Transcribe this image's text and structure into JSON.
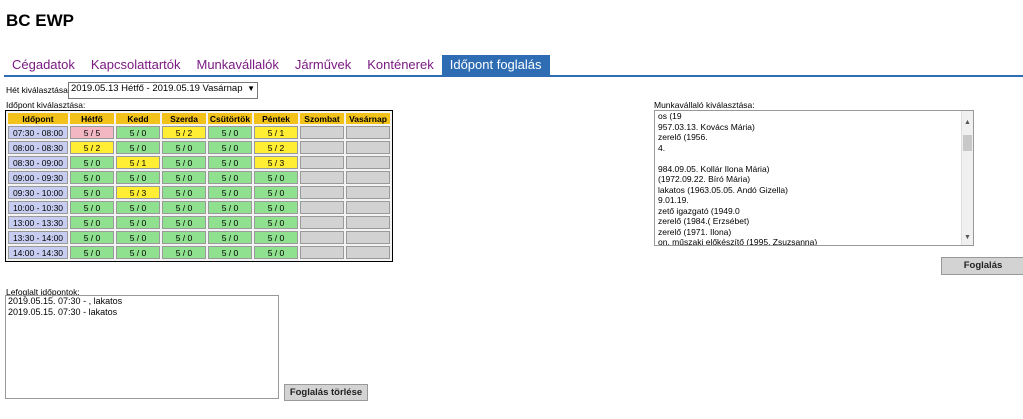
{
  "title": "BC EWP",
  "tabs": [
    {
      "label": "Cégadatok",
      "active": false
    },
    {
      "label": "Kapcsolattartók",
      "active": false
    },
    {
      "label": "Munkavállalók",
      "active": false
    },
    {
      "label": "Járművek",
      "active": false
    },
    {
      "label": "Konténerek",
      "active": false
    },
    {
      "label": "Időpont foglalás",
      "active": true
    }
  ],
  "week": {
    "label": "Hét kiválasztása:",
    "selected": "2019.05.13 Hétfő - 2019.05.19 Vasárnap"
  },
  "time_selection": {
    "label": "Időpont kiválasztása:",
    "header": [
      "Időpont",
      "Hétfő",
      "Kedd",
      "Szerda",
      "Csütörtök",
      "Péntek",
      "Szombat",
      "Vasárnap"
    ],
    "rows": [
      {
        "time": "07:30 - 08:00",
        "cells": [
          {
            "t": "5 / 5",
            "s": "red"
          },
          {
            "t": "5 / 0",
            "s": "grn"
          },
          {
            "t": "5 / 2",
            "s": "yel"
          },
          {
            "t": "5 / 0",
            "s": "grn"
          },
          {
            "t": "5 / 1",
            "s": "yel"
          },
          {
            "t": "",
            "s": "gry"
          },
          {
            "t": "",
            "s": "gry"
          }
        ]
      },
      {
        "time": "08:00 - 08:30",
        "cells": [
          {
            "t": "5 / 2",
            "s": "yel"
          },
          {
            "t": "5 / 0",
            "s": "grn"
          },
          {
            "t": "5 / 0",
            "s": "grn"
          },
          {
            "t": "5 / 0",
            "s": "grn"
          },
          {
            "t": "5 / 2",
            "s": "yel"
          },
          {
            "t": "",
            "s": "gry"
          },
          {
            "t": "",
            "s": "gry"
          }
        ]
      },
      {
        "time": "08:30 - 09:00",
        "cells": [
          {
            "t": "5 / 0",
            "s": "grn"
          },
          {
            "t": "5 / 1",
            "s": "yel"
          },
          {
            "t": "5 / 0",
            "s": "grn"
          },
          {
            "t": "5 / 0",
            "s": "grn"
          },
          {
            "t": "5 / 3",
            "s": "yel"
          },
          {
            "t": "",
            "s": "gry"
          },
          {
            "t": "",
            "s": "gry"
          }
        ]
      },
      {
        "time": "09:00 - 09:30",
        "cells": [
          {
            "t": "5 / 0",
            "s": "grn"
          },
          {
            "t": "5 / 0",
            "s": "grn"
          },
          {
            "t": "5 / 0",
            "s": "grn"
          },
          {
            "t": "5 / 0",
            "s": "grn"
          },
          {
            "t": "5 / 0",
            "s": "grn"
          },
          {
            "t": "",
            "s": "gry"
          },
          {
            "t": "",
            "s": "gry"
          }
        ]
      },
      {
        "time": "09:30 - 10:00",
        "cells": [
          {
            "t": "5 / 0",
            "s": "grn"
          },
          {
            "t": "5 / 3",
            "s": "yel"
          },
          {
            "t": "5 / 0",
            "s": "grn"
          },
          {
            "t": "5 / 0",
            "s": "grn"
          },
          {
            "t": "5 / 0",
            "s": "grn"
          },
          {
            "t": "",
            "s": "gry"
          },
          {
            "t": "",
            "s": "gry"
          }
        ]
      },
      {
        "time": "10:00 - 10:30",
        "cells": [
          {
            "t": "5 / 0",
            "s": "grn"
          },
          {
            "t": "5 / 0",
            "s": "grn"
          },
          {
            "t": "5 / 0",
            "s": "grn"
          },
          {
            "t": "5 / 0",
            "s": "grn"
          },
          {
            "t": "5 / 0",
            "s": "grn"
          },
          {
            "t": "",
            "s": "gry"
          },
          {
            "t": "",
            "s": "gry"
          }
        ]
      },
      {
        "time": "13:00 - 13:30",
        "cells": [
          {
            "t": "5 / 0",
            "s": "grn"
          },
          {
            "t": "5 / 0",
            "s": "grn"
          },
          {
            "t": "5 / 0",
            "s": "grn"
          },
          {
            "t": "5 / 0",
            "s": "grn"
          },
          {
            "t": "5 / 0",
            "s": "grn"
          },
          {
            "t": "",
            "s": "gry"
          },
          {
            "t": "",
            "s": "gry"
          }
        ]
      },
      {
        "time": "13:30 - 14:00",
        "cells": [
          {
            "t": "5 / 0",
            "s": "grn"
          },
          {
            "t": "5 / 0",
            "s": "grn"
          },
          {
            "t": "5 / 0",
            "s": "grn"
          },
          {
            "t": "5 / 0",
            "s": "grn"
          },
          {
            "t": "5 / 0",
            "s": "grn"
          },
          {
            "t": "",
            "s": "gry"
          },
          {
            "t": "",
            "s": "gry"
          }
        ]
      },
      {
        "time": "14:00 - 14:30",
        "cells": [
          {
            "t": "5 / 0",
            "s": "grn"
          },
          {
            "t": "5 / 0",
            "s": "grn"
          },
          {
            "t": "5 / 0",
            "s": "grn"
          },
          {
            "t": "5 / 0",
            "s": "grn"
          },
          {
            "t": "5 / 0",
            "s": "grn"
          },
          {
            "t": "",
            "s": "gry"
          },
          {
            "t": "",
            "s": "gry"
          }
        ]
      }
    ]
  },
  "employees": {
    "label": "Munkavállaló kiválasztása:",
    "items": [
      "os (19",
      "957.03.13. Kovács Mária)",
      "zerelő (1956.",
      "4.",
      "",
      "984.09.05. Kollár Ilona Mária)",
      "(1972.09.22. Bíró Mária)",
      "lakatos (1963.05.05. Andó Gizella)",
      "9.01.19.",
      "zető igazgató (1949.0",
      "zerelő (1984.(                 Erzsébet)",
      "zerelő (1971.                   Ilona)",
      "on, műszaki előkészítő (1995.                Zsuzsanna)"
    ]
  },
  "book_button": "Foglalás",
  "booked": {
    "label": "Lefoglalt időpontok:",
    "items": [
      "2019.05.15. 07:30 -                          , lakatos",
      "2019.05.15. 07:30 -                           lakatos"
    ]
  },
  "delete_button": "Foglalás törlése"
}
